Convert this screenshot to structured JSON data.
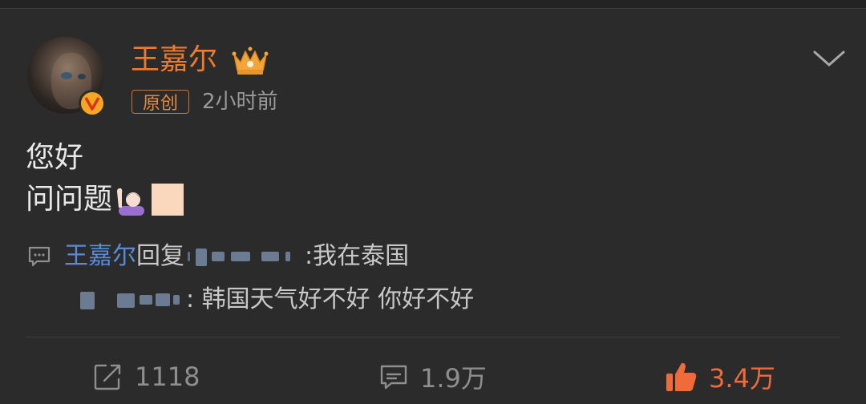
{
  "post": {
    "author": "王嘉尔",
    "original_tag": "原创",
    "time": "2小时前",
    "text_line1": "您好",
    "text_line2": "问问题"
  },
  "reply": {
    "name": "王嘉尔",
    "reply_word": "回复",
    "text": ":我在泰国",
    "sub_text": ": 韩国天气好不好 你好不好"
  },
  "actions": {
    "repost_count": "1118",
    "comment_count": "1.9万",
    "like_count": "3.4万"
  },
  "colors": {
    "background": "#2b2b2b",
    "author_orange": "#f07a2a",
    "reply_blue": "#5a8ad6",
    "like_orange": "#f06a3a"
  },
  "icons": [
    "crown-icon",
    "verified-v-icon",
    "chevron-down-icon",
    "comment-icon",
    "repost-icon",
    "like-thumb-icon"
  ]
}
